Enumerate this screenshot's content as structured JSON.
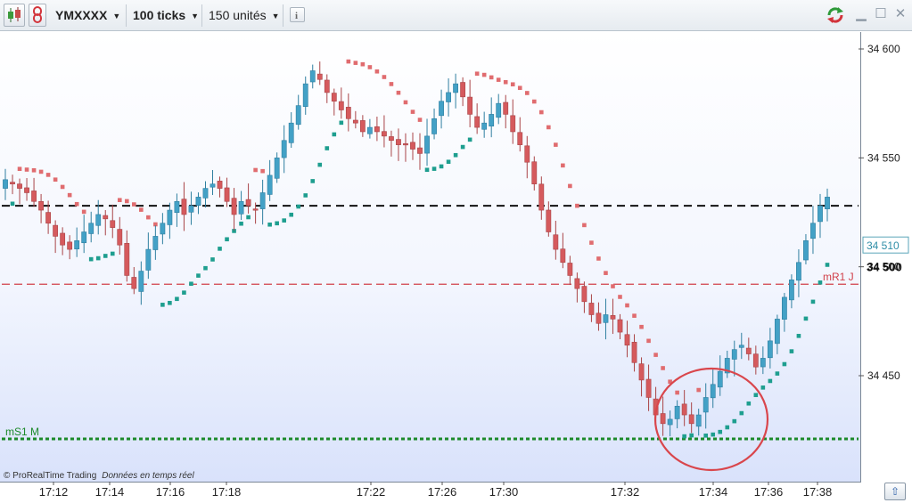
{
  "toolbar": {
    "symbol": "YMXXXX",
    "tick_mode": "100 ticks",
    "units": "150 unités",
    "info_icon": "info-icon",
    "refresh_icon": "refresh-arrows-icon",
    "minimize_icon": "minimize-icon",
    "maximize_icon": "maximize-icon",
    "close_icon": "close-icon"
  },
  "footer": {
    "copyright": "© ProRealTime Trading",
    "realtime_note": "Données en temps réel",
    "scroll_icon": "scroll-to-end-icon"
  },
  "colors": {
    "bull_candle": "#43a1c6",
    "bear_candle": "#d55a5d",
    "sar_bear": "#e06c6f",
    "sar_bull": "#1e9e8f",
    "pivot_r1": "#d1404a",
    "pivot_s1": "#1c8a2a",
    "highlight_circle": "#d9464c"
  },
  "chart_data": {
    "type": "candlestick",
    "ylim": [
      34406,
      34612
    ],
    "y_ticks": [
      "34 600",
      "34 550",
      "34 500",
      "34 450"
    ],
    "x_tick_labels": [
      "17:12",
      "17:14",
      "17:16",
      "17:18",
      "17:22",
      "17:26",
      "17:30",
      "17:32",
      "17:34",
      "17:36",
      "17:38"
    ],
    "current_price": 34510,
    "current_price_label": "34 510",
    "levels": [
      {
        "name": "mR1 J",
        "value": 34492,
        "style": "dashed",
        "color": "#d1404a"
      },
      {
        "name": "mS1 M",
        "value": 34421,
        "style": "dotted",
        "color": "#1c8a2a"
      },
      {
        "name": "",
        "value": 34528,
        "style": "dashed",
        "color": "#111111"
      }
    ],
    "y_tick_values": [
      34600,
      34550,
      34500,
      34450
    ],
    "y_bold_label": "34 500",
    "close": [
      34540,
      34538,
      34536,
      34534,
      34530,
      34526,
      34520,
      34514,
      34510,
      34508,
      34512,
      34516,
      34520,
      34524,
      34522,
      34518,
      34510,
      34496,
      34490,
      34498,
      34508,
      34514,
      34520,
      34526,
      34530,
      34524,
      34528,
      34532,
      34536,
      34538,
      34536,
      34530,
      34524,
      34530,
      34528,
      34526,
      34534,
      34542,
      34550,
      34558,
      34566,
      34574,
      34584,
      34590,
      34586,
      34580,
      34576,
      34572,
      34568,
      34566,
      34562,
      34564,
      34562,
      34560,
      34558,
      34556,
      34556,
      34554,
      34552,
      34560,
      34568,
      34576,
      34580,
      34584,
      34578,
      34570,
      34564,
      34566,
      34570,
      34575,
      34570,
      34562,
      34556,
      34548,
      34538,
      34526,
      34516,
      34508,
      34502,
      34496,
      34490,
      34484,
      34478,
      34474,
      34478,
      34476,
      34470,
      34464,
      34456,
      34448,
      34440,
      34432,
      34428,
      34430,
      34436,
      34432,
      34428,
      34432,
      34440,
      34446,
      34452,
      34458,
      34462,
      34464,
      34460,
      34454,
      34458,
      34466,
      34476,
      34486,
      34494,
      34502,
      34512,
      34520,
      34528,
      34532
    ]
  }
}
